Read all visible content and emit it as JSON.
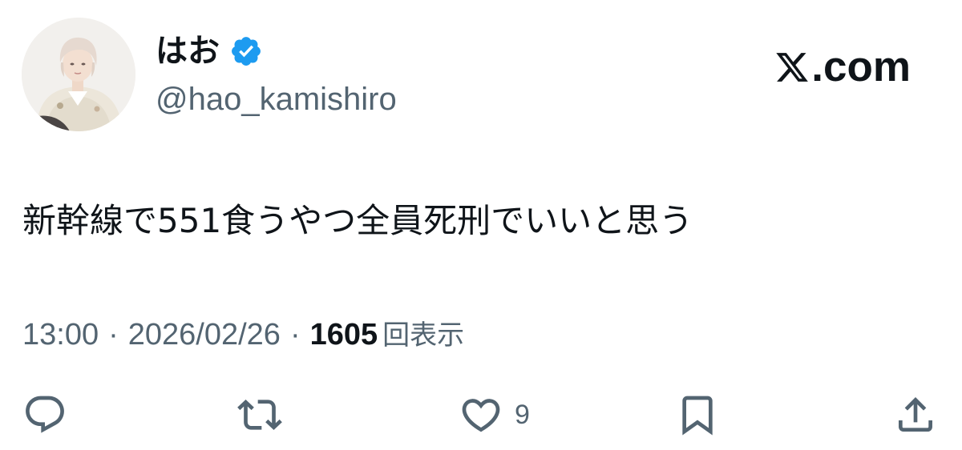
{
  "author": {
    "display_name": "はお",
    "handle": "@hao_kamishiro",
    "verified": true,
    "avatar_icon": "profile-photo"
  },
  "brand": {
    "label": ".com",
    "logo_icon": "x-logo-icon"
  },
  "tweet": {
    "text": "新幹線で551食うやつ全員死刑でいいと思う"
  },
  "meta": {
    "time": "13:00",
    "separator": "·",
    "date": "2026/02/26",
    "views_count": "1605",
    "views_label": "回表示"
  },
  "actions": {
    "reply_icon": "reply-icon",
    "retweet_icon": "retweet-icon",
    "like_icon": "heart-icon",
    "like_count": "9",
    "bookmark_icon": "bookmark-icon",
    "share_icon": "share-icon"
  },
  "colors": {
    "text_primary": "#0f1419",
    "text_secondary": "#536471",
    "verified_blue": "#1d9bf0",
    "background": "#ffffff"
  }
}
